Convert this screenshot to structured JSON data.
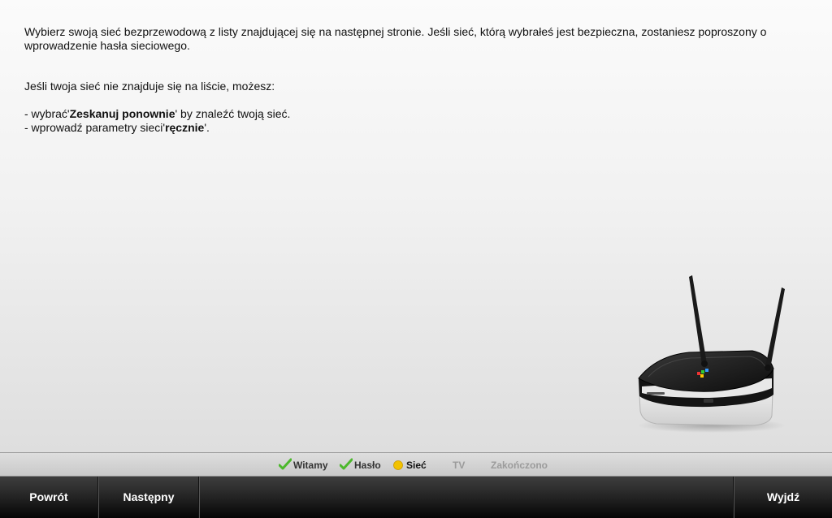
{
  "instructions": {
    "para1": "Wybierz swoją sieć bezprzewodową z listy znajdującej się na następnej stronie. Jeśli sieć, którą wybrałeś jest bezpieczna, zostaniesz poproszony o wprowadzenie hasła sieciowego.",
    "para2": "Jeśli twoja sieć nie znajduje się na liście, możesz:",
    "opt1_prefix": "- wybrać'",
    "opt1_bold": "Zeskanuj ponownie",
    "opt1_suffix": "' by znaleźć twoją sieć.",
    "opt2_prefix": "- wprowadź parametry sieci'",
    "opt2_bold": "ręcznie",
    "opt2_suffix": "'."
  },
  "progress": {
    "steps": [
      {
        "label": "Witamy",
        "state": "done",
        "icon": "check-icon"
      },
      {
        "label": "Hasło",
        "state": "done",
        "icon": "check-icon"
      },
      {
        "label": "Sieć",
        "state": "current",
        "icon": "yellow-dot-icon"
      },
      {
        "label": "TV",
        "state": "pending"
      },
      {
        "label": "Zakończono",
        "state": "pending"
      }
    ]
  },
  "footer": {
    "back_label": "Powrót",
    "next_label": "Następny",
    "exit_label": "Wyjdź"
  },
  "colors": {
    "check": "#4cb82c",
    "current_dot": "#f2c200",
    "footer_bg": "#1c1c1c"
  }
}
